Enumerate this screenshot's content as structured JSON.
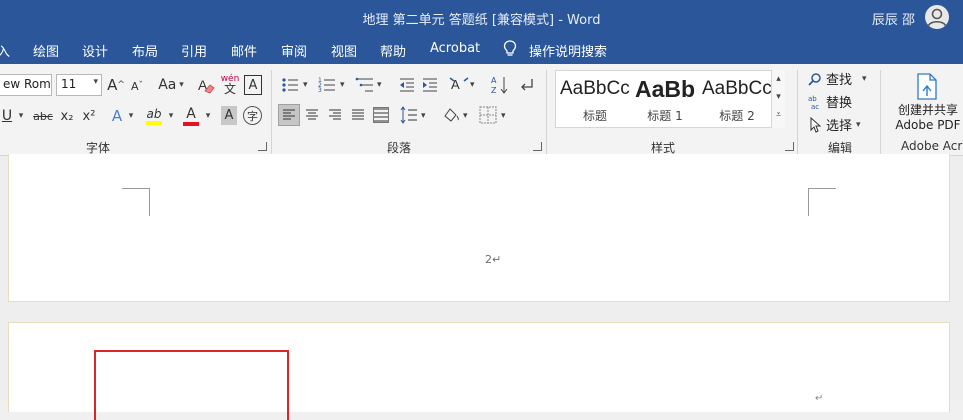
{
  "window": {
    "title": "地理 第二单元 答题纸 [兼容模式] - Word",
    "user": "辰辰 邵"
  },
  "menu": {
    "tabs": [
      "入",
      "绘图",
      "设计",
      "布局",
      "引用",
      "邮件",
      "审阅",
      "视图",
      "帮助",
      "Acrobat"
    ],
    "tell_me": "操作说明搜索"
  },
  "ribbon": {
    "font": {
      "font_name": "ew Roma",
      "font_size": "11",
      "grow": "A",
      "shrink": "A",
      "case": "Aa",
      "phonetic": "wén\n文",
      "border_char": "A",
      "underline": "U",
      "strike": "abc",
      "subscript": "x₂",
      "superscript": "x²",
      "text_effects": "A",
      "highlight": "ab",
      "font_color": "A",
      "char_shading": "A",
      "enclose": "字",
      "label": "字体"
    },
    "paragraph": {
      "label": "段落"
    },
    "styles": {
      "label": "样式",
      "items": [
        {
          "sample": "AaBbCcI",
          "name": "标题"
        },
        {
          "sample": "AaBb",
          "name": "标题 1"
        },
        {
          "sample": "AaBbCcI",
          "name": "标题 2"
        }
      ]
    },
    "editing": {
      "label": "编辑",
      "find": "查找",
      "replace": "替换",
      "select": "选择"
    },
    "acrobat": {
      "button": "创建并共享\nAdobe PDF",
      "label": "Adobe Acr"
    }
  },
  "document": {
    "page_number": "2↵",
    "para_mark": "↵"
  },
  "colors": {
    "accent": "#2b579a",
    "highlight": "#ffff00",
    "font_color": "#ff0000",
    "red_box": "#d9262b"
  }
}
